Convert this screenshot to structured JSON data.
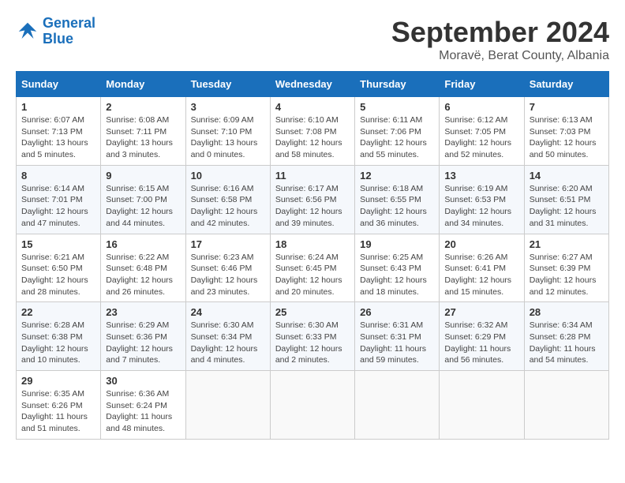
{
  "logo": {
    "line1": "General",
    "line2": "Blue"
  },
  "title": "September 2024",
  "location": "Moravë, Berat County, Albania",
  "headers": [
    "Sunday",
    "Monday",
    "Tuesday",
    "Wednesday",
    "Thursday",
    "Friday",
    "Saturday"
  ],
  "weeks": [
    [
      {
        "day": "1",
        "detail": "Sunrise: 6:07 AM\nSunset: 7:13 PM\nDaylight: 13 hours\nand 5 minutes."
      },
      {
        "day": "2",
        "detail": "Sunrise: 6:08 AM\nSunset: 7:11 PM\nDaylight: 13 hours\nand 3 minutes."
      },
      {
        "day": "3",
        "detail": "Sunrise: 6:09 AM\nSunset: 7:10 PM\nDaylight: 13 hours\nand 0 minutes."
      },
      {
        "day": "4",
        "detail": "Sunrise: 6:10 AM\nSunset: 7:08 PM\nDaylight: 12 hours\nand 58 minutes."
      },
      {
        "day": "5",
        "detail": "Sunrise: 6:11 AM\nSunset: 7:06 PM\nDaylight: 12 hours\nand 55 minutes."
      },
      {
        "day": "6",
        "detail": "Sunrise: 6:12 AM\nSunset: 7:05 PM\nDaylight: 12 hours\nand 52 minutes."
      },
      {
        "day": "7",
        "detail": "Sunrise: 6:13 AM\nSunset: 7:03 PM\nDaylight: 12 hours\nand 50 minutes."
      }
    ],
    [
      {
        "day": "8",
        "detail": "Sunrise: 6:14 AM\nSunset: 7:01 PM\nDaylight: 12 hours\nand 47 minutes."
      },
      {
        "day": "9",
        "detail": "Sunrise: 6:15 AM\nSunset: 7:00 PM\nDaylight: 12 hours\nand 44 minutes."
      },
      {
        "day": "10",
        "detail": "Sunrise: 6:16 AM\nSunset: 6:58 PM\nDaylight: 12 hours\nand 42 minutes."
      },
      {
        "day": "11",
        "detail": "Sunrise: 6:17 AM\nSunset: 6:56 PM\nDaylight: 12 hours\nand 39 minutes."
      },
      {
        "day": "12",
        "detail": "Sunrise: 6:18 AM\nSunset: 6:55 PM\nDaylight: 12 hours\nand 36 minutes."
      },
      {
        "day": "13",
        "detail": "Sunrise: 6:19 AM\nSunset: 6:53 PM\nDaylight: 12 hours\nand 34 minutes."
      },
      {
        "day": "14",
        "detail": "Sunrise: 6:20 AM\nSunset: 6:51 PM\nDaylight: 12 hours\nand 31 minutes."
      }
    ],
    [
      {
        "day": "15",
        "detail": "Sunrise: 6:21 AM\nSunset: 6:50 PM\nDaylight: 12 hours\nand 28 minutes."
      },
      {
        "day": "16",
        "detail": "Sunrise: 6:22 AM\nSunset: 6:48 PM\nDaylight: 12 hours\nand 26 minutes."
      },
      {
        "day": "17",
        "detail": "Sunrise: 6:23 AM\nSunset: 6:46 PM\nDaylight: 12 hours\nand 23 minutes."
      },
      {
        "day": "18",
        "detail": "Sunrise: 6:24 AM\nSunset: 6:45 PM\nDaylight: 12 hours\nand 20 minutes."
      },
      {
        "day": "19",
        "detail": "Sunrise: 6:25 AM\nSunset: 6:43 PM\nDaylight: 12 hours\nand 18 minutes."
      },
      {
        "day": "20",
        "detail": "Sunrise: 6:26 AM\nSunset: 6:41 PM\nDaylight: 12 hours\nand 15 minutes."
      },
      {
        "day": "21",
        "detail": "Sunrise: 6:27 AM\nSunset: 6:39 PM\nDaylight: 12 hours\nand 12 minutes."
      }
    ],
    [
      {
        "day": "22",
        "detail": "Sunrise: 6:28 AM\nSunset: 6:38 PM\nDaylight: 12 hours\nand 10 minutes."
      },
      {
        "day": "23",
        "detail": "Sunrise: 6:29 AM\nSunset: 6:36 PM\nDaylight: 12 hours\nand 7 minutes."
      },
      {
        "day": "24",
        "detail": "Sunrise: 6:30 AM\nSunset: 6:34 PM\nDaylight: 12 hours\nand 4 minutes."
      },
      {
        "day": "25",
        "detail": "Sunrise: 6:30 AM\nSunset: 6:33 PM\nDaylight: 12 hours\nand 2 minutes."
      },
      {
        "day": "26",
        "detail": "Sunrise: 6:31 AM\nSunset: 6:31 PM\nDaylight: 11 hours\nand 59 minutes."
      },
      {
        "day": "27",
        "detail": "Sunrise: 6:32 AM\nSunset: 6:29 PM\nDaylight: 11 hours\nand 56 minutes."
      },
      {
        "day": "28",
        "detail": "Sunrise: 6:34 AM\nSunset: 6:28 PM\nDaylight: 11 hours\nand 54 minutes."
      }
    ],
    [
      {
        "day": "29",
        "detail": "Sunrise: 6:35 AM\nSunset: 6:26 PM\nDaylight: 11 hours\nand 51 minutes."
      },
      {
        "day": "30",
        "detail": "Sunrise: 6:36 AM\nSunset: 6:24 PM\nDaylight: 11 hours\nand 48 minutes."
      },
      null,
      null,
      null,
      null,
      null
    ]
  ]
}
